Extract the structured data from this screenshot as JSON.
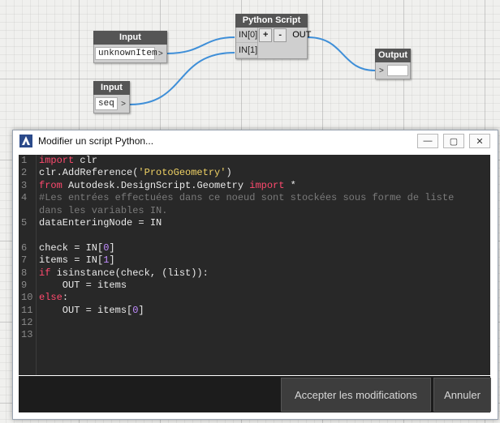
{
  "canvas": {
    "input_node_1": {
      "title": "Input",
      "value": "unknownItem",
      "port_arrow": ">"
    },
    "input_node_2": {
      "title": "Input",
      "value": "seq",
      "port_arrow": ">"
    },
    "python_node": {
      "title": "Python Script",
      "inputs": [
        "IN[0]",
        "IN[1]"
      ],
      "add_label": "+",
      "remove_label": "-",
      "output": "OUT"
    },
    "output_node": {
      "title": "Output",
      "port_arrow": ">"
    },
    "wire_color": "#3f8fd8"
  },
  "dialog": {
    "title": "Modifier un script Python...",
    "window_buttons": {
      "minimize": "—",
      "maximize": "▢",
      "close": "✕"
    },
    "line_numbers": [
      "1",
      "2",
      "3",
      "4",
      "",
      "5",
      "",
      "6",
      "7",
      "8",
      "9",
      "10",
      "11",
      "12",
      "13"
    ],
    "code_lines": [
      [
        {
          "t": "kw",
          "v": "import"
        },
        {
          "t": "plain",
          "v": " clr"
        }
      ],
      [
        {
          "t": "plain",
          "v": "clr.AddReference("
        },
        {
          "t": "str",
          "v": "'ProtoGeometry'"
        },
        {
          "t": "plain",
          "v": ")"
        }
      ],
      [
        {
          "t": "kw",
          "v": "from"
        },
        {
          "t": "plain",
          "v": " Autodesk.DesignScript.Geometry "
        },
        {
          "t": "kw",
          "v": "import"
        },
        {
          "t": "plain",
          "v": " *"
        }
      ],
      [
        {
          "t": "com",
          "v": "#Les entrées effectuées dans ce noeud sont stockées sous forme de liste"
        }
      ],
      [
        {
          "t": "com",
          "v": "dans les variables IN."
        }
      ],
      [
        {
          "t": "plain",
          "v": "dataEnteringNode = IN"
        }
      ],
      [
        {
          "t": "plain",
          "v": ""
        }
      ],
      [
        {
          "t": "plain",
          "v": "check = IN["
        },
        {
          "t": "num",
          "v": "0"
        },
        {
          "t": "plain",
          "v": "]"
        }
      ],
      [
        {
          "t": "plain",
          "v": "items = IN["
        },
        {
          "t": "num",
          "v": "1"
        },
        {
          "t": "plain",
          "v": "]"
        }
      ],
      [
        {
          "t": "kw",
          "v": "if"
        },
        {
          "t": "plain",
          "v": " isinstance(check, (list)):"
        }
      ],
      [
        {
          "t": "plain",
          "v": "    OUT = items"
        }
      ],
      [
        {
          "t": "kw",
          "v": "else"
        },
        {
          "t": "plain",
          "v": ":"
        }
      ],
      [
        {
          "t": "plain",
          "v": "    OUT = items["
        },
        {
          "t": "num",
          "v": "0"
        },
        {
          "t": "plain",
          "v": "]"
        }
      ],
      [
        {
          "t": "plain",
          "v": ""
        }
      ],
      [
        {
          "t": "plain",
          "v": ""
        }
      ]
    ],
    "accept_label": "Accepter les modifications",
    "cancel_label": "Annuler"
  }
}
